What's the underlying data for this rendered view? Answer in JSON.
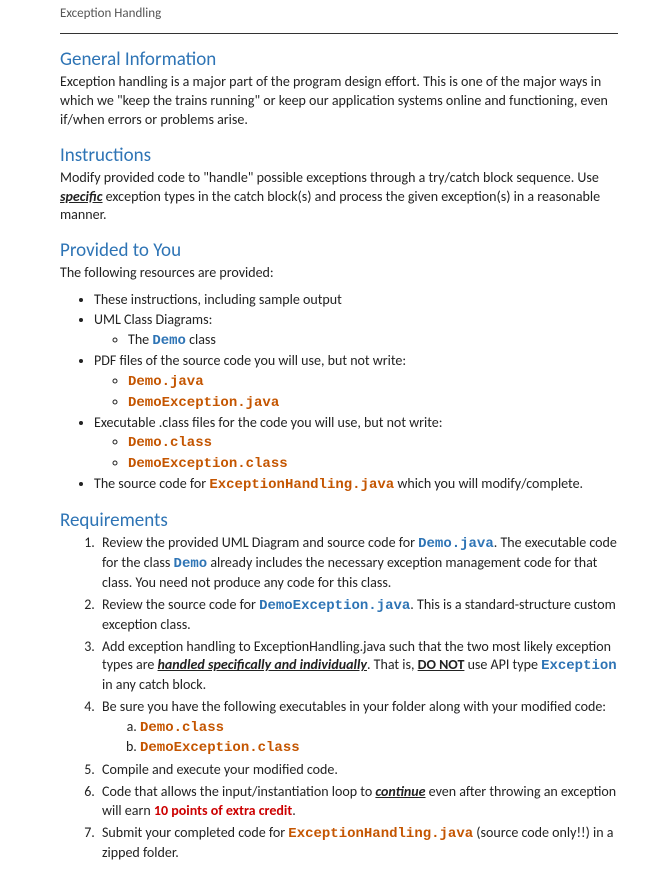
{
  "header": "Exception Handling",
  "sections": {
    "general": {
      "title": "General Information",
      "body_pre": "Exception handling is a major part of the program design effort. This is one of the major ways in which we \"keep the trains running\" or keep our application systems online and functioning, even if/when errors or problems arise."
    },
    "instructions": {
      "title": "Instructions",
      "body_pre": "Modify provided code to \"handle\" possible exceptions through a try/catch block sequence. Use ",
      "specific": "specific",
      "body_post": " exception types in the catch block(s) and process the given exception(s) in a reasonable manner."
    },
    "provided": {
      "title": "Provided to You",
      "intro": "The following resources are provided:",
      "item1": "These instructions, including sample output",
      "item2": "UML Class Diagrams:",
      "item2a_pre": "The ",
      "item2a_code": "Demo",
      "item2a_post": "  class",
      "item3": "PDF files of the source code you will use, but not write:",
      "item3a": "Demo.java",
      "item3b": "DemoException.java",
      "item4": "Executable .class files for the code you will use, but not write:",
      "item4a": "Demo.class",
      "item4b": "DemoException.class",
      "item5_pre": "The source code for ",
      "item5_code": "ExceptionHandling.java",
      "item5_post": " which you will modify/complete."
    },
    "requirements": {
      "title": "Requirements",
      "r1_pre": "Review the provided UML Diagram and source code for ",
      "r1_code": "Demo.java",
      "r1_mid": ". The executable code for the class ",
      "r1_code2": "Demo",
      "r1_post": " already includes the necessary exception management code for that class. You need not produce any code for this class.",
      "r2_pre": "Review the source code for ",
      "r2_code": "DemoException.java",
      "r2_post": ". This is a standard-structure custom exception class.",
      "r3_pre": "Add exception handling to ExceptionHandling.java such that the two most likely exception types are ",
      "r3_bi": "handled specifically and individually",
      "r3_mid": ". That is, ",
      "r3_u": "DO NOT",
      "r3_mid2": " use API type ",
      "r3_code": "Exception",
      "r3_post": " in any catch block.",
      "r4": "Be sure you have the following executables in your folder along with your modified code:",
      "r4a": "Demo.class",
      "r4b": "DemoException.class",
      "r5": "Compile and execute your modified code.",
      "r6_pre": "Code that allows the input/instantiation loop to ",
      "r6_u": "continue",
      "r6_mid": " even after throwing an exception will earn ",
      "r6_red": "10 points of extra credit",
      "r6_post": ".",
      "r7_pre": "Submit your completed code for ",
      "r7_code": "ExceptionHandling.java",
      "r7_post": " (source code only!!) in a zipped folder."
    }
  }
}
